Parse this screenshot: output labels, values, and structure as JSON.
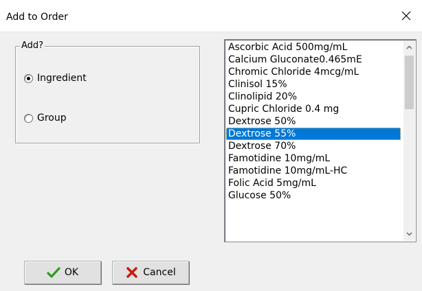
{
  "window": {
    "title": "Add to Order",
    "close_icon": "close-icon"
  },
  "add_group": {
    "legend": "Add?",
    "options": [
      {
        "label": "Ingredient",
        "checked": true
      },
      {
        "label": "Group",
        "checked": false
      }
    ]
  },
  "list": {
    "items": [
      "Ascorbic Acid 500mg/mL",
      "Calcium Gluconate0.465mE",
      "Chromic Chloride 4mcg/mL",
      "Clinisol 15%",
      "Clinolipid 20%",
      "Cupric Chloride 0.4 mg",
      "Dextrose 50%",
      "Dextrose 55%",
      "Dextrose 70%",
      "Famotidine 10mg/mL",
      "Famotidine 10mg/mL-HC",
      "Folic Acid 5mg/mL",
      "Glucose 50%"
    ],
    "selected_item": "Dextrose 55%",
    "selection_color": "#0078d7"
  },
  "buttons": {
    "ok_label": "OK",
    "ok_icon": "checkmark-icon",
    "ok_icon_color": "#2e9b1f",
    "cancel_label": "Cancel",
    "cancel_icon": "x-mark-icon",
    "cancel_icon_color": "#c81e0e"
  }
}
